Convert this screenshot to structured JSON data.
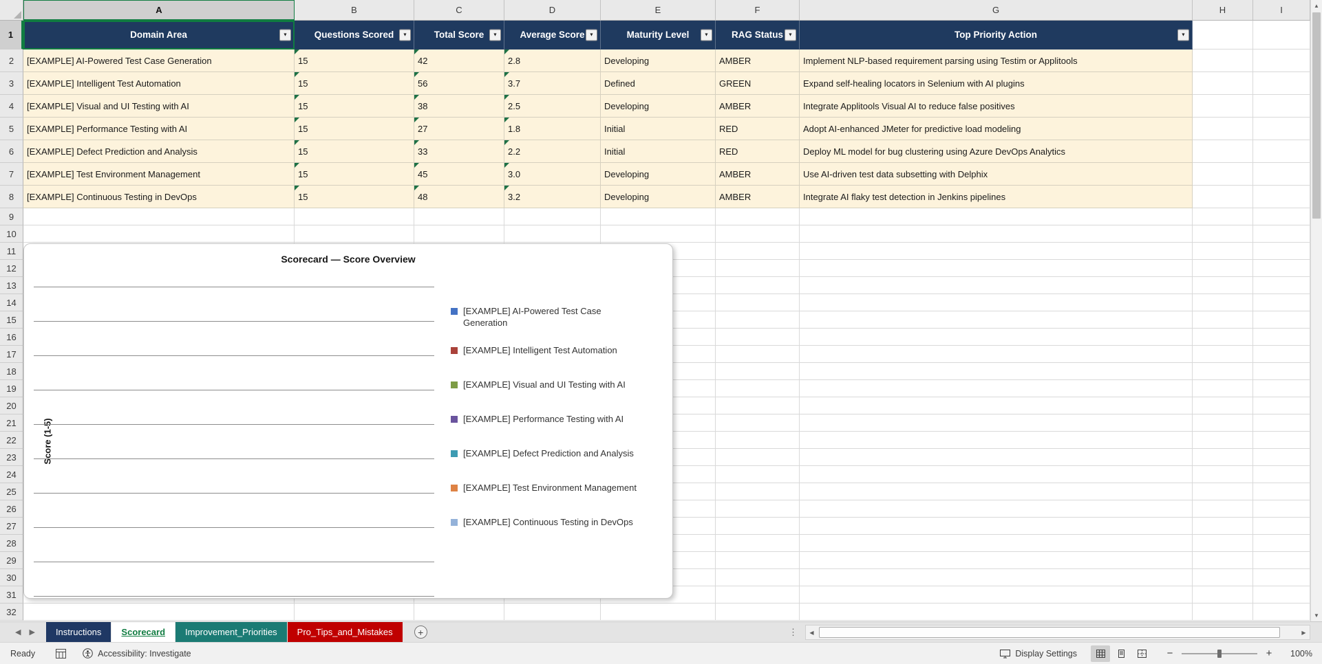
{
  "grid": {
    "columns": [
      "A",
      "B",
      "C",
      "D",
      "E",
      "F",
      "G",
      "H",
      "I"
    ],
    "selected_column": "A",
    "selected_row": "1",
    "row_count": 32
  },
  "table": {
    "headers": [
      "Domain Area",
      "Questions Scored",
      "Total Score",
      "Average Score",
      "Maturity Level",
      "RAG Status",
      "Top Priority Action"
    ],
    "flagged_columns": [
      "B",
      "C",
      "D"
    ],
    "rows": [
      [
        "[EXAMPLE] AI-Powered Test Case Generation",
        "15",
        "42",
        "2.8",
        "Developing",
        "AMBER",
        "Implement NLP-based requirement parsing using Testim or Applitools"
      ],
      [
        "[EXAMPLE] Intelligent Test Automation",
        "15",
        "56",
        "3.7",
        "Defined",
        "GREEN",
        "Expand self-healing locators in Selenium with AI plugins"
      ],
      [
        "[EXAMPLE] Visual and UI Testing with AI",
        "15",
        "38",
        "2.5",
        "Developing",
        "AMBER",
        "Integrate Applitools Visual AI to reduce false positives"
      ],
      [
        "[EXAMPLE] Performance Testing with AI",
        "15",
        "27",
        "1.8",
        "Initial",
        "RED",
        "Adopt AI-enhanced JMeter for predictive load modeling"
      ],
      [
        "[EXAMPLE] Defect Prediction and Analysis",
        "15",
        "33",
        "2.2",
        "Initial",
        "RED",
        "Deploy ML model for bug clustering using Azure DevOps Analytics"
      ],
      [
        "[EXAMPLE] Test Environment Management",
        "15",
        "45",
        "3.0",
        "Developing",
        "AMBER",
        "Use AI-driven test data subsetting with Delphix"
      ],
      [
        "[EXAMPLE] Continuous Testing in DevOps",
        "15",
        "48",
        "3.2",
        "Developing",
        "AMBER",
        "Integrate AI flaky test detection in Jenkins pipelines"
      ]
    ]
  },
  "chart_data": {
    "type": "line",
    "title": "Scorecard — Score Overview",
    "ylabel": "Score (1-5)",
    "legend_position": "right",
    "gridlines": true,
    "series": [
      {
        "name": "[EXAMPLE] AI-Powered Test Case Generation",
        "color": "#4472C4"
      },
      {
        "name": "[EXAMPLE] Intelligent Test Automation",
        "color": "#AA423A"
      },
      {
        "name": "[EXAMPLE] Visual and UI Testing with AI",
        "color": "#7D9C45"
      },
      {
        "name": "[EXAMPLE] Performance Testing with AI",
        "color": "#6A549E"
      },
      {
        "name": "[EXAMPLE] Defect Prediction and Analysis",
        "color": "#3D9BB2"
      },
      {
        "name": "[EXAMPLE] Test Environment Management",
        "color": "#DE8244"
      },
      {
        "name": "[EXAMPLE] Continuous Testing in DevOps",
        "color": "#94B2D9"
      }
    ]
  },
  "sheet_tabs": [
    {
      "label": "Instructions",
      "color": "#1F3864",
      "active": false
    },
    {
      "label": "Scorecard",
      "color": "#107C41",
      "active": true
    },
    {
      "label": "Improvement_Priorities",
      "color": "#1B7B74",
      "active": false
    },
    {
      "label": "Pro_Tips_and_Mistakes",
      "color": "#C00000",
      "active": false
    }
  ],
  "status_bar": {
    "ready": "Ready",
    "accessibility": "Accessibility: Investigate",
    "display_settings": "Display Settings",
    "zoom_level": "100%"
  }
}
